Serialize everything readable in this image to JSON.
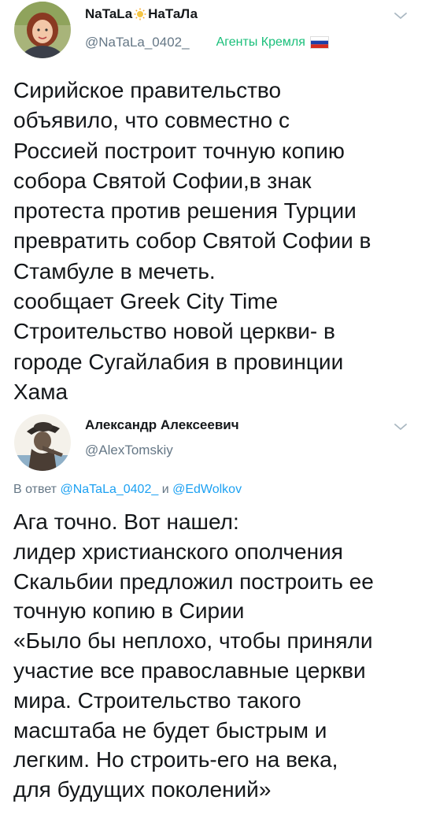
{
  "tweet1": {
    "display_name_part1": "NaTaLa",
    "display_name_part2": "НаТаЛа",
    "name_emoji": "sun-icon",
    "handle": "@NaTaLa_0402_",
    "tag": "Агенты Кремля",
    "tag_emoji": "russia-flag-icon",
    "text": "Сирийское правительство\nобъявило, что совместно с\nРоссией построит точную копию\nсобора Святой Софии,в знак\nпротеста против решения Турции\nпревратить собор Святой Софии в\nСтамбуле в мечеть.\nсообщает Greek City Time\nСтроительство новой церкви- в\nгороде Сугайлабия в провинции\nХама"
  },
  "tweet2": {
    "display_name": "Александр Алексеевич",
    "handle": "@AlexTomskiy",
    "reply_prefix": "В ответ",
    "reply_user1": "@NaTaLa_0402_",
    "reply_and": "и",
    "reply_user2": "@EdWolkov",
    "text": "Ага точно. Вот нашел:\nлидер христианского ополчения\nСкальбии предложил построить ее\nточную копию в Сирии\n«Было бы неплохо, чтобы приняли\nучастие все православные церкви\nмира. Строительство такого\nмасштаба не будет быстрым и\nлегким. Но строить-его на века,\nдля будущих поколений»"
  },
  "colors": {
    "link": "#1da1f2",
    "secondary": "#657786",
    "tag_green": "#19bf7a",
    "text": "#14171a"
  }
}
